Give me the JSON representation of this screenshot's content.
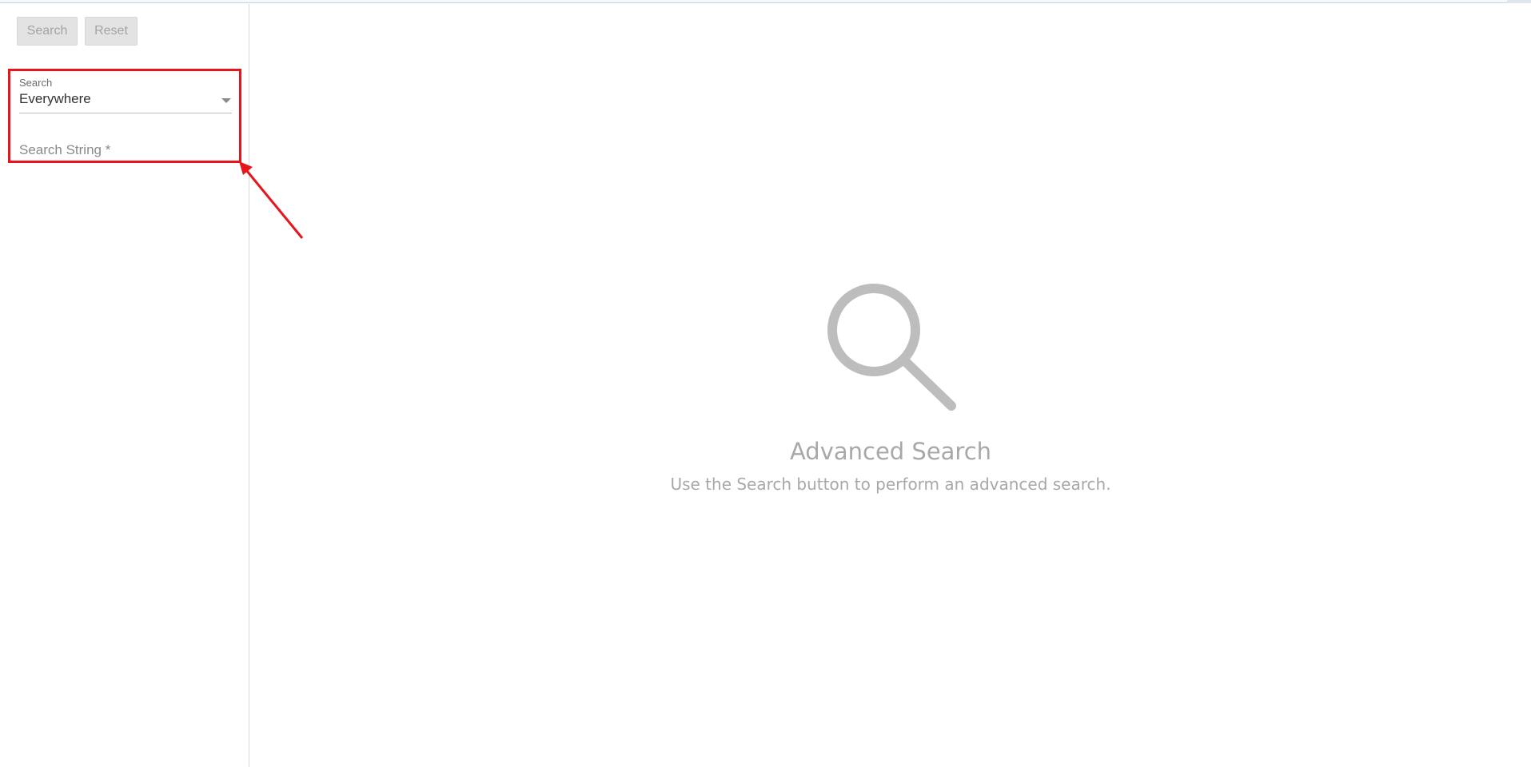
{
  "toolbar": {
    "search_label": "Search",
    "reset_label": "Reset"
  },
  "filters": {
    "scope_label": "Search",
    "scope_value": "Everywhere",
    "search_string_label": "Search String *"
  },
  "empty_state": {
    "icon": "search-icon",
    "title": "Advanced Search",
    "subtitle": "Use the Search button to perform an advanced search."
  },
  "annotation": {
    "highlight_color": "#e8141b"
  }
}
